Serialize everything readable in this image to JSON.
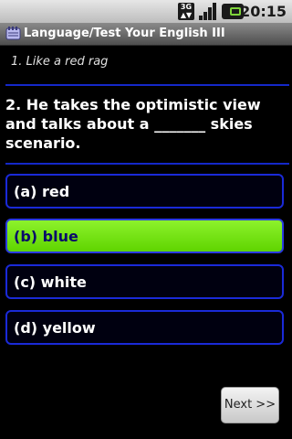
{
  "status_bar": {
    "network_label": "3G",
    "time": "20:15",
    "icons": [
      "network-3g-icon",
      "signal-strength-icon",
      "battery-icon"
    ]
  },
  "title_bar": {
    "title": "Language/Test Your English III",
    "icon": "notebook-icon"
  },
  "clue": "1. Like a red rag",
  "question": "2. He takes the optimistic view and talks about a _______ skies scenario.",
  "options": [
    {
      "label": "(a) red",
      "selected": false
    },
    {
      "label": "(b) blue",
      "selected": true
    },
    {
      "label": "(c) white",
      "selected": false
    },
    {
      "label": "(d) yellow",
      "selected": false
    }
  ],
  "next_label": "Next >>",
  "colors": {
    "accent_blue": "#1a2ad8",
    "selected_green": "#7fe81a",
    "background": "#000000"
  }
}
